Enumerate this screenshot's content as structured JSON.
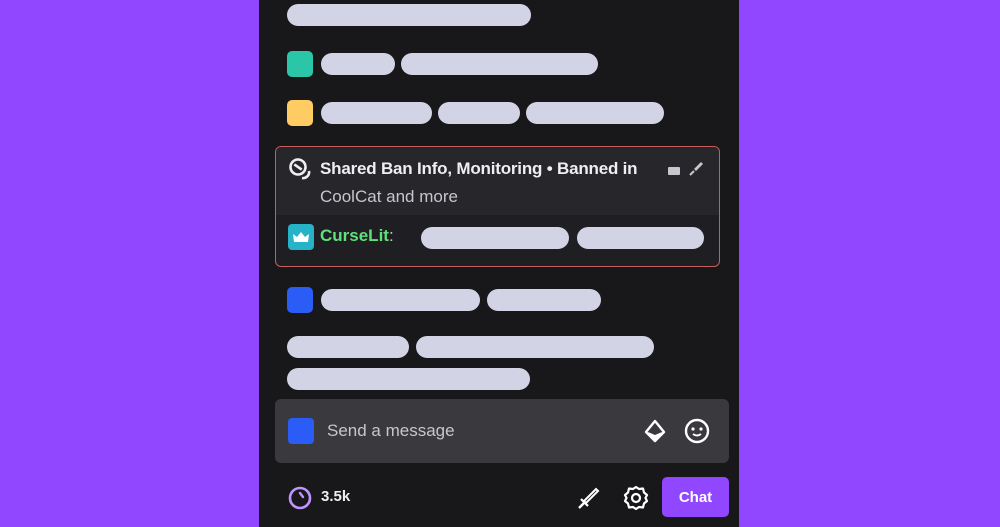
{
  "colors": {
    "page_background": "#9146ff",
    "panel_background": "#18181b",
    "placeholder_pill": "#d3d3e6",
    "ban_border": "#c55e5a",
    "username_green": "#5ee07a",
    "accent_purple": "#9146ff"
  },
  "chat": {
    "messages": [
      {
        "badge_color": null,
        "pills": 1
      },
      {
        "badge_color": "#2bc6a8",
        "pills": 2
      },
      {
        "badge_color": "#ffcb63",
        "pills": 3
      },
      {
        "badge_color": "#2b5cf6",
        "pills": 2
      },
      {
        "badge_color": null,
        "pills": 3
      }
    ],
    "ban_notice": {
      "icon": "shared-ban-icon",
      "title": "Shared Ban Info, Monitoring • Banned in",
      "subtitle": "CoolCat and more",
      "actions": [
        "collapse-icon",
        "pin-icon"
      ],
      "user": {
        "badge_icon": "crown-icon",
        "badge_color": "#26b3c7",
        "name": "CurseLit",
        "separator": ":"
      }
    }
  },
  "input": {
    "placeholder": "Send a message",
    "value": "",
    "avatar_color": "#2b5cf6",
    "icons": [
      "bits-icon",
      "emote-icon"
    ]
  },
  "footer": {
    "points_icon": "channel-points-icon",
    "points_count": "3.5k",
    "icons": [
      "mod-sword-icon",
      "settings-gear-icon"
    ],
    "chat_button_label": "Chat"
  }
}
